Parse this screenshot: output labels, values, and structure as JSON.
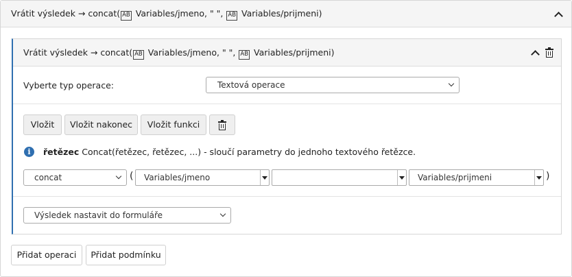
{
  "outer": {
    "header_prefix": "Vrátit výsledek → concat(",
    "ab_badge": "AB",
    "var1": "Variables/jmeno",
    "mid_text": ", \" \", ",
    "var2": "Variables/prijmeni",
    "suffix": ")",
    "collapse_icon": "chevron-up-icon"
  },
  "inner": {
    "header_prefix": "Vrátit výsledek → concat(",
    "ab_badge": "AB",
    "var1": "Variables/jmeno",
    "mid_text": ", \" \", ",
    "var2": "Variables/prijmeni",
    "suffix": ")",
    "collapse_icon": "chevron-up-icon",
    "delete_icon": "trash-icon"
  },
  "operation_type": {
    "label": "Vyberte typ operace:",
    "selected": "Textová operace"
  },
  "toolbar": {
    "insert": "Vložit",
    "insert_end": "Vložit nakonec",
    "insert_function": "Vložit funkci",
    "delete_icon": "trash-icon"
  },
  "info": {
    "icon": "info-icon",
    "return_type": "řetězec",
    "signature": " Concat(řetězec, řetězec, ...)",
    "description": " - sloučí parametry do jednoho textového řetězce."
  },
  "expression": {
    "function": "concat",
    "open_paren": "(",
    "arg1": "Variables/jmeno",
    "arg2": "",
    "arg3": "Variables/prijmeni",
    "close_paren": ")"
  },
  "result_target": {
    "selected": "Výsledek nastavit do formuláře"
  },
  "footer": {
    "add_operation": "Přidat operaci",
    "add_condition": "Přidat podmínku"
  },
  "colors": {
    "accent": "#2f6fb0",
    "header_bg": "#f5f5f5",
    "button_bg": "#efefef"
  }
}
